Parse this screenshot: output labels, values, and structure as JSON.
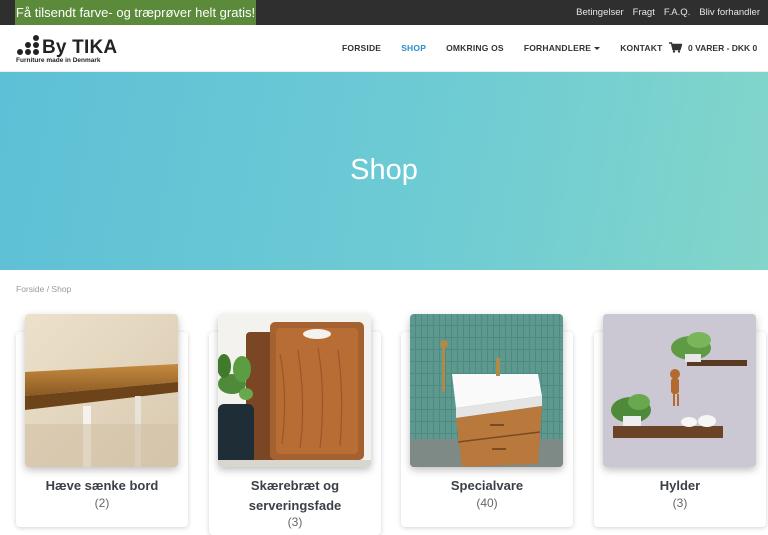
{
  "topbar": {
    "promo": "Få tilsendt farve- og træprøver helt gratis!",
    "links": [
      "Betingelser",
      "Fragt",
      "F.A.Q.",
      "Bliv forhandler"
    ]
  },
  "logo": {
    "name": "By TIKA",
    "tagline": "Furniture made in Denmark"
  },
  "nav": {
    "items": [
      "FORSIDE",
      "SHOP",
      "OMKRING OS",
      "FORHANDLERE",
      "KONTAKT"
    ],
    "active": "SHOP"
  },
  "cart": {
    "label": "0 VARER - DKK 0"
  },
  "hero": {
    "title": "Shop"
  },
  "breadcrumb": "Forside / Shop",
  "categories": [
    {
      "name": "Hæve sænke bord",
      "count": "(2)"
    },
    {
      "name": "Skærebræt og serveringsfade",
      "count": "(3)"
    },
    {
      "name": "Specialvare",
      "count": "(40)"
    },
    {
      "name": "Hylder",
      "count": "(3)"
    }
  ],
  "colors": {
    "promo_bg": "#5a8a3a",
    "topbar_bg": "#2f2f2f",
    "nav_active": "#2b8fce",
    "hero_start": "#5ec0d6",
    "hero_end": "#82d5ca"
  }
}
